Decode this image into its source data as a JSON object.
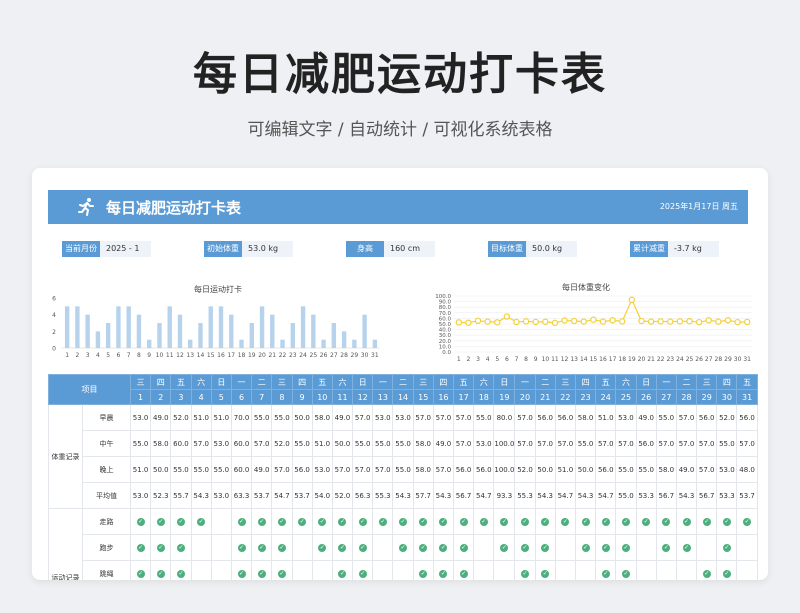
{
  "page_title": "每日减肥运动打卡表",
  "subtitle": "可编辑文字 / 自动统计 / 可视化系统表格",
  "banner": {
    "title": "每日减肥运动打卡表",
    "date": "2025年1月17日 周五"
  },
  "info": [
    {
      "label": "当前月份",
      "value": "2025 - 1"
    },
    {
      "label": "初始体重",
      "value": "53.0 kg"
    },
    {
      "label": "身高",
      "value": "160 cm"
    },
    {
      "label": "目标体重",
      "value": "50.0 kg"
    },
    {
      "label": "累计减重",
      "value": "-3.7 kg"
    }
  ],
  "colors": {
    "accent": "#5b9bd5",
    "bar": "#b7d3ec",
    "line": "#f2d13b",
    "check": "#4caf7d"
  },
  "chart_data": [
    {
      "type": "bar",
      "title": "每日运动打卡",
      "x": [
        1,
        2,
        3,
        4,
        5,
        6,
        7,
        8,
        9,
        10,
        11,
        12,
        13,
        14,
        15,
        16,
        17,
        18,
        19,
        20,
        21,
        22,
        23,
        24,
        25,
        26,
        27,
        28,
        29,
        30,
        31
      ],
      "values": [
        5,
        5,
        4,
        2,
        3,
        5,
        5,
        4,
        1,
        3,
        5,
        4,
        1,
        3,
        5,
        5,
        4,
        1,
        3,
        5,
        4,
        1,
        3,
        5,
        4,
        1,
        3,
        2,
        1,
        4,
        1
      ],
      "ylim": [
        0,
        6
      ],
      "yticks": [
        0,
        2,
        4,
        6
      ],
      "grid": false
    },
    {
      "type": "line",
      "title": "每日体重变化",
      "x": [
        1,
        2,
        3,
        4,
        5,
        6,
        7,
        8,
        9,
        10,
        11,
        12,
        13,
        14,
        15,
        16,
        17,
        18,
        19,
        20,
        21,
        22,
        23,
        24,
        25,
        26,
        27,
        28,
        29,
        30,
        31
      ],
      "values": [
        53.0,
        52.3,
        55.7,
        54.3,
        53.0,
        63.3,
        53.7,
        54.7,
        53.7,
        54.0,
        52.0,
        56.3,
        55.3,
        54.3,
        57.7,
        54.3,
        56.7,
        54.7,
        93.3,
        55.3,
        54.3,
        54.7,
        54.3,
        54.7,
        55.0,
        53.3,
        56.7,
        54.3,
        56.7,
        53.3,
        53.7
      ],
      "ylim": [
        0,
        100
      ],
      "yticks": [
        "0.0",
        "10.0",
        "20.0",
        "30.0",
        "40.0",
        "50.0",
        "60.0",
        "70.0",
        "80.0",
        "90.0",
        "100.0"
      ],
      "grid": true
    }
  ],
  "table": {
    "header_label": "项目",
    "weekdays": [
      "三",
      "四",
      "五",
      "六",
      "日",
      "一",
      "二",
      "三",
      "四",
      "五",
      "六",
      "日",
      "一",
      "二",
      "三",
      "四",
      "五",
      "六",
      "日",
      "一",
      "二",
      "三",
      "四",
      "五",
      "六",
      "日",
      "一",
      "二",
      "三",
      "四",
      "五"
    ],
    "days": [
      "1",
      "2",
      "3",
      "4",
      "5",
      "6",
      "7",
      "8",
      "9",
      "10",
      "11",
      "12",
      "13",
      "14",
      "15",
      "16",
      "17",
      "18",
      "19",
      "20",
      "21",
      "22",
      "23",
      "24",
      "25",
      "26",
      "27",
      "28",
      "29",
      "30",
      "31"
    ],
    "weight_group": "体重记录",
    "weight_rows": [
      {
        "label": "早晨",
        "values": [
          "53.0",
          "49.0",
          "52.0",
          "51.0",
          "51.0",
          "70.0",
          "55.0",
          "55.0",
          "50.0",
          "58.0",
          "49.0",
          "57.0",
          "53.0",
          "53.0",
          "57.0",
          "57.0",
          "57.0",
          "55.0",
          "80.0",
          "57.0",
          "56.0",
          "56.0",
          "58.0",
          "51.0",
          "53.0",
          "49.0",
          "55.0",
          "57.0",
          "56.0",
          "52.0",
          "56.0"
        ]
      },
      {
        "label": "中午",
        "values": [
          "55.0",
          "58.0",
          "60.0",
          "57.0",
          "53.0",
          "60.0",
          "57.0",
          "52.0",
          "55.0",
          "51.0",
          "50.0",
          "55.0",
          "55.0",
          "55.0",
          "58.0",
          "49.0",
          "57.0",
          "53.0",
          "100.0",
          "57.0",
          "57.0",
          "57.0",
          "55.0",
          "57.0",
          "57.0",
          "56.0",
          "57.0",
          "57.0",
          "57.0",
          "55.0",
          "57.0"
        ]
      },
      {
        "label": "晚上",
        "values": [
          "51.0",
          "50.0",
          "55.0",
          "55.0",
          "55.0",
          "60.0",
          "49.0",
          "57.0",
          "56.0",
          "53.0",
          "57.0",
          "57.0",
          "57.0",
          "55.0",
          "58.0",
          "57.0",
          "56.0",
          "56.0",
          "100.0",
          "52.0",
          "50.0",
          "51.0",
          "50.0",
          "56.0",
          "55.0",
          "55.0",
          "58.0",
          "49.0",
          "57.0",
          "53.0",
          "48.0"
        ]
      },
      {
        "label": "平均值",
        "values": [
          "53.0",
          "52.3",
          "55.7",
          "54.3",
          "53.0",
          "63.3",
          "53.7",
          "54.7",
          "53.7",
          "54.0",
          "52.0",
          "56.3",
          "55.3",
          "54.3",
          "57.7",
          "54.3",
          "56.7",
          "54.7",
          "93.3",
          "55.3",
          "54.3",
          "54.7",
          "54.3",
          "54.7",
          "55.0",
          "53.3",
          "56.7",
          "54.3",
          "56.7",
          "53.3",
          "53.7"
        ]
      }
    ],
    "exercise_group": "运动记录",
    "exercise_rows": [
      {
        "label": "走路",
        "checks": [
          1,
          1,
          1,
          1,
          0,
          1,
          1,
          1,
          1,
          1,
          1,
          1,
          1,
          1,
          1,
          1,
          1,
          1,
          1,
          1,
          1,
          1,
          1,
          1,
          1,
          1,
          1,
          1,
          1,
          1,
          1
        ]
      },
      {
        "label": "跑步",
        "checks": [
          1,
          1,
          1,
          0,
          0,
          1,
          1,
          1,
          0,
          1,
          1,
          1,
          0,
          1,
          1,
          1,
          1,
          0,
          1,
          1,
          1,
          0,
          1,
          1,
          1,
          0,
          1,
          1,
          0,
          1,
          0
        ]
      },
      {
        "label": "跳绳",
        "checks": [
          1,
          1,
          1,
          0,
          0,
          1,
          1,
          1,
          0,
          0,
          1,
          1,
          0,
          0,
          1,
          1,
          1,
          0,
          0,
          1,
          1,
          0,
          0,
          1,
          1,
          0,
          0,
          0,
          1,
          1,
          0
        ]
      }
    ]
  }
}
